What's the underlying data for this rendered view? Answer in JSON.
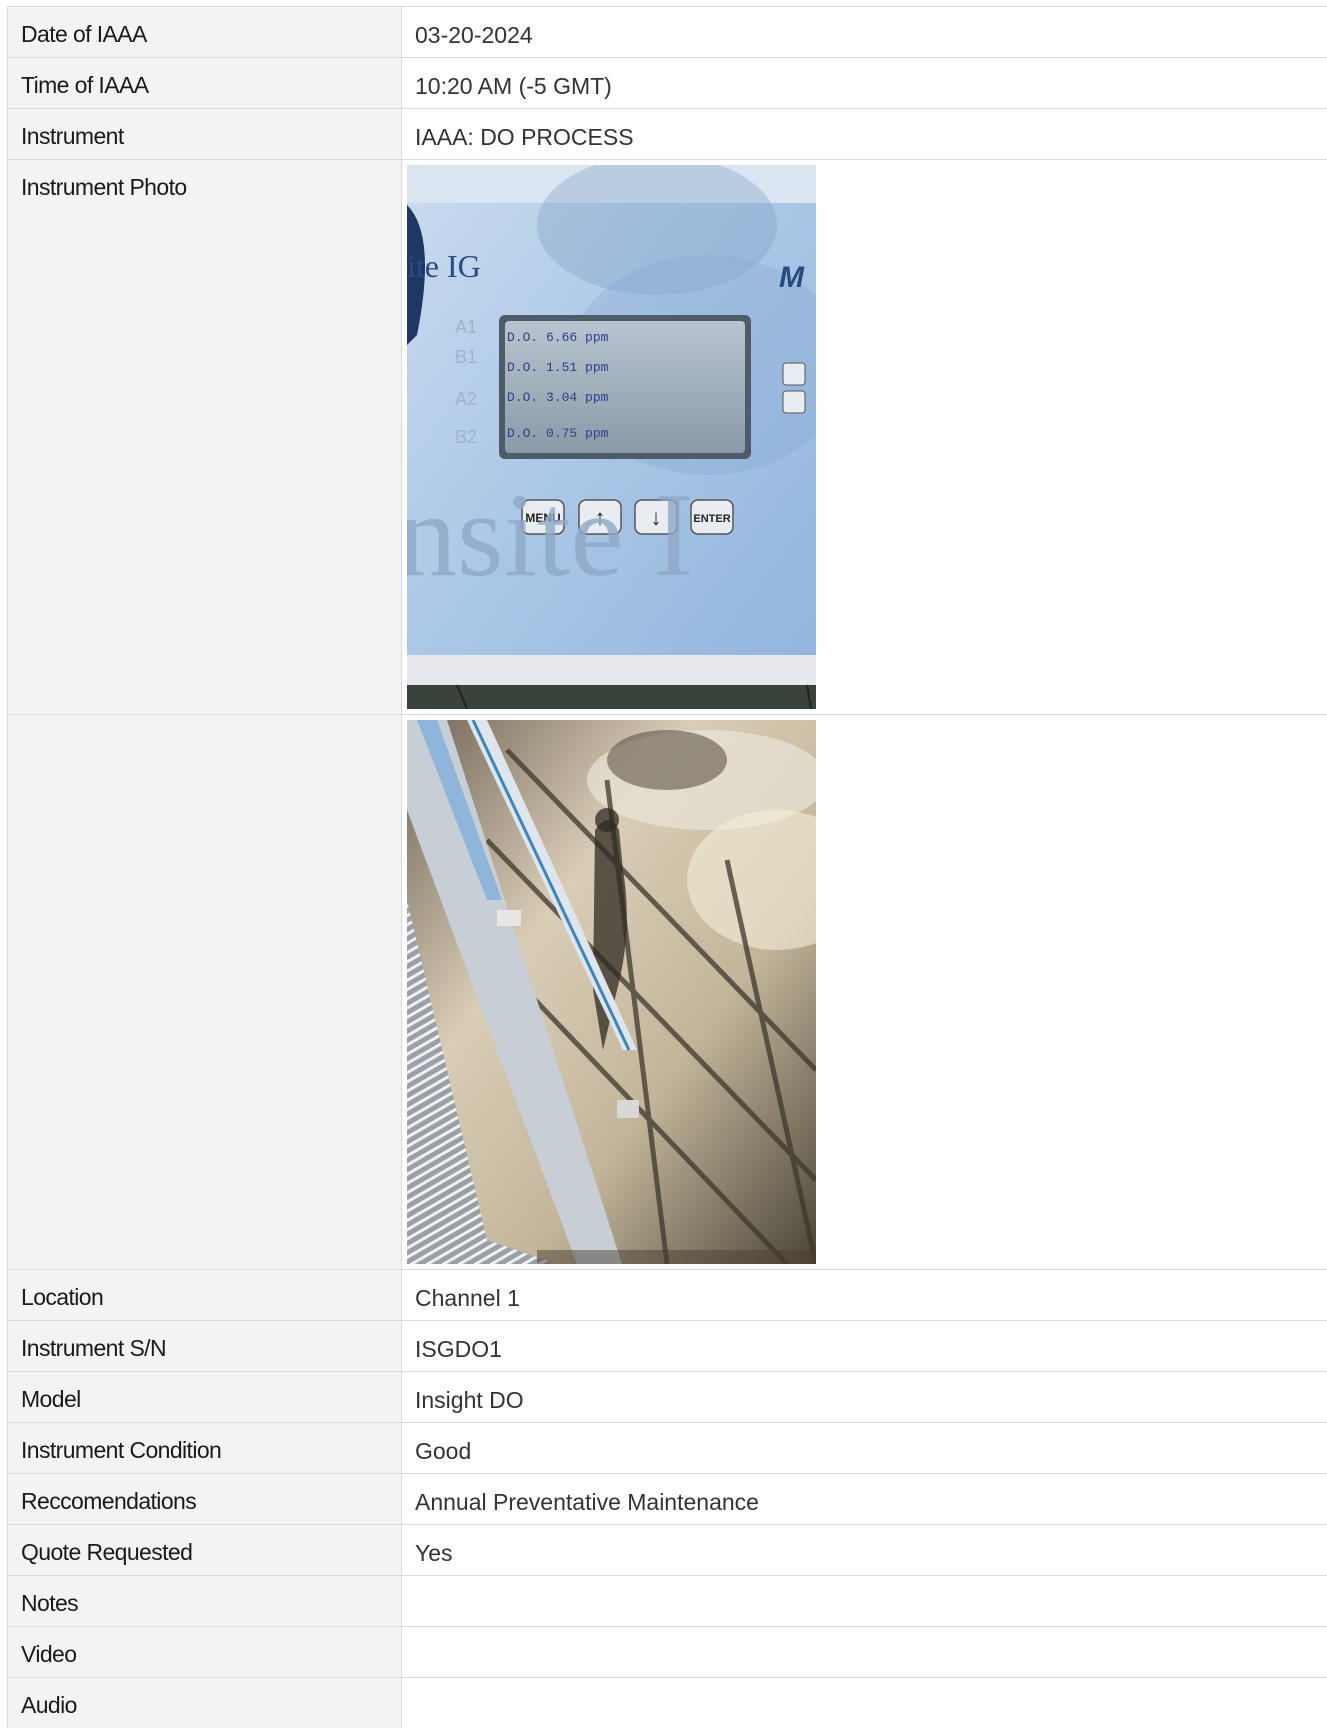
{
  "rows": {
    "date": {
      "label": "Date of IAAA",
      "value": "03-20-2024"
    },
    "time": {
      "label": "Time of IAAA",
      "value": "10:20 AM (-5 GMT)"
    },
    "instrument": {
      "label": "Instrument",
      "value": "IAAA: DO PROCESS"
    },
    "photo": {
      "label": "Instrument Photo",
      "label2": ""
    },
    "location": {
      "label": "Location",
      "value": "Channel 1"
    },
    "serial": {
      "label": "Instrument S/N",
      "value": "ISGDO1"
    },
    "model": {
      "label": "Model",
      "value": "Insight DO"
    },
    "condition": {
      "label": "Instrument Condition",
      "value": "Good"
    },
    "recommendations": {
      "label": "Reccomendations",
      "value": "Annual Preventative Maintenance"
    },
    "quote": {
      "label": "Quote Requested",
      "value": "Yes"
    },
    "notes": {
      "label": "Notes",
      "value": ""
    },
    "video": {
      "label": "Video",
      "value": ""
    },
    "audio": {
      "label": "Audio",
      "value": ""
    }
  },
  "photo1": {
    "logo": "ite IG",
    "brand_partial": "M",
    "watermark": "nsite I",
    "channels": [
      "A1",
      "B1",
      "A2",
      "B2"
    ],
    "readings": [
      {
        "line": "D.O.  6.66 ppm"
      },
      {
        "line": "D.O.  1.51 ppm"
      },
      {
        "line": "D.O.  3.04 ppm"
      },
      {
        "line": "D.O.  0.75 ppm"
      }
    ],
    "buttons": {
      "menu": "MENU",
      "enter": "ENTER",
      "up": "↑",
      "down": "↓"
    }
  }
}
